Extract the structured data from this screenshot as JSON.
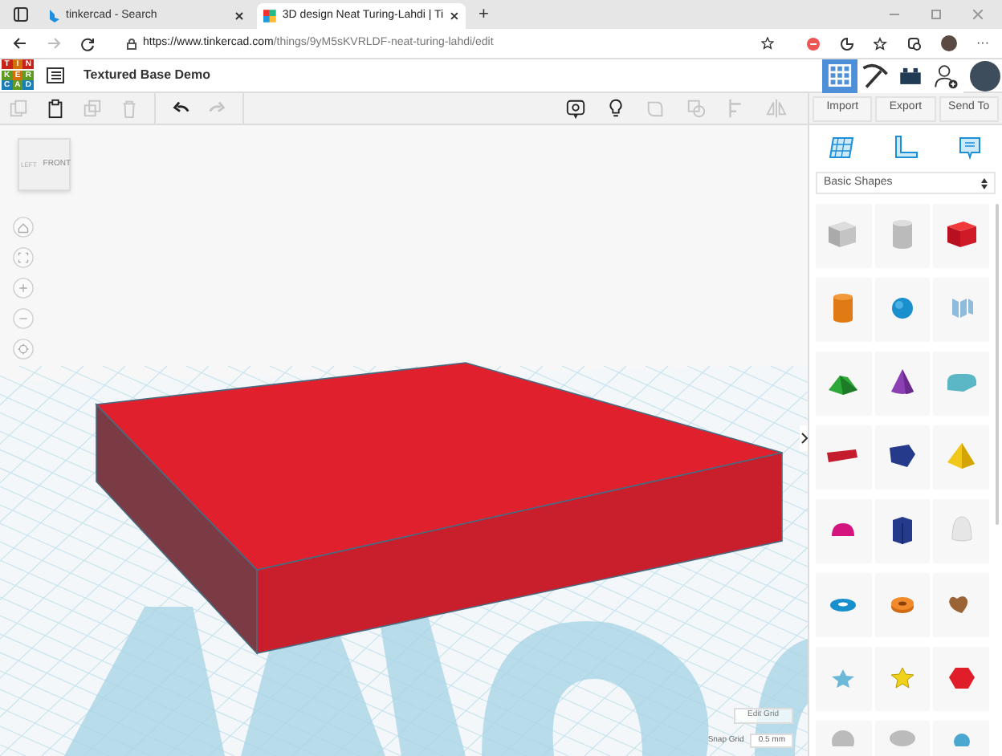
{
  "browser": {
    "tabs": [
      {
        "title": "tinkercad - Search",
        "selected": false
      },
      {
        "title": "3D design Neat Turing-Lahdi | Ti",
        "selected": true
      }
    ],
    "new_tab": "+",
    "url_host": "https://www.tinkercad.com",
    "url_path": "/things/9yM5sKVRLDF-neat-turing-lahdi/edit",
    "menu": "···"
  },
  "app": {
    "logo": [
      "T",
      "I",
      "N",
      "K",
      "E",
      "R",
      "C",
      "A",
      "D"
    ],
    "design_title": "Textured Base Demo",
    "header_buttons": [
      {
        "kind": "grid",
        "selected": true
      },
      {
        "kind": "pickaxe",
        "selected": false
      },
      {
        "kind": "bricks",
        "selected": false
      },
      {
        "kind": "add-user",
        "selected": false
      }
    ]
  },
  "toolbar": {
    "left": [
      {
        "kind": "copy",
        "disabled": true
      },
      {
        "kind": "paste",
        "disabled": false
      },
      {
        "kind": "duplicate",
        "disabled": true
      },
      {
        "kind": "delete",
        "disabled": true
      },
      {
        "kind": "undo",
        "disabled": false
      },
      {
        "kind": "redo",
        "disabled": true
      }
    ],
    "right": [
      {
        "kind": "note",
        "disabled": false
      },
      {
        "kind": "bulb",
        "disabled": false
      },
      {
        "kind": "group",
        "disabled": true
      },
      {
        "kind": "ungroup",
        "disabled": true
      },
      {
        "kind": "align",
        "disabled": true
      },
      {
        "kind": "mirror",
        "disabled": true
      }
    ]
  },
  "panel": {
    "buttons": [
      "Import",
      "Export",
      "Send To"
    ],
    "library": "Basic Shapes"
  },
  "view_cube": {
    "left": "LEFT",
    "front": "FRONT"
  },
  "grid": {
    "edit": "Edit Grid",
    "snap_label": "Snap Grid",
    "snap_value": "0.5 mm"
  }
}
